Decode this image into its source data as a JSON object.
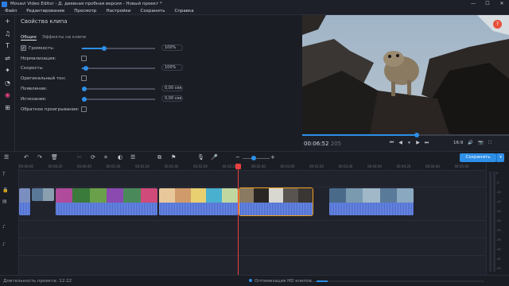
{
  "window": {
    "title": "Movavi Video Editor - Д. диевная пробная версия - Новый проект *",
    "minimize": "—",
    "maximize": "☐",
    "close": "✕"
  },
  "menu": [
    "Файл",
    "Редактирование",
    "Просмотр",
    "Настройки",
    "Сохранить",
    "Справка"
  ],
  "left_tools": [
    {
      "name": "add-media-icon",
      "glyph": "+"
    },
    {
      "name": "music-icon",
      "glyph": "♫"
    },
    {
      "name": "titles-icon",
      "glyph": "T"
    },
    {
      "name": "transitions-icon",
      "glyph": "⇌"
    },
    {
      "name": "filters-icon",
      "glyph": "✦"
    },
    {
      "name": "stickers-icon",
      "glyph": "◔"
    },
    {
      "name": "effects-icon",
      "glyph": "◉"
    },
    {
      "name": "more-tools-icon",
      "glyph": "⊞"
    }
  ],
  "clip_props": {
    "title": "Свойства клипа",
    "tab_general": "Общие",
    "tab_effects": "Эффекты на клипе",
    "volume_label": "Громкость:",
    "volume_value": "100%",
    "volume_pct": 0.3,
    "normalize_label": "Нормализация:",
    "speed_label": "Скорость:",
    "speed_value": "100%",
    "speed_pct": 0.05,
    "original_tone_label": "Оригинальный тон:",
    "fade_in_label": "Появление:",
    "fade_in_value": "0,00 сек",
    "fade_out_label": "Исчезание:",
    "fade_out_value": "0,00 сек",
    "reverse_label": "Обратное проигрывание:"
  },
  "player": {
    "time_main": "00:06:52",
    "time_ms": "205",
    "aspect": "16:9",
    "progress": 0.56,
    "help": "?"
  },
  "timeline": {
    "save_button": "Сохранить",
    "ruler_ticks": [
      "00:00:00",
      "00:00:20",
      "00:00:40",
      "00:01:00",
      "00:01:20",
      "00:01:40",
      "00:02:00",
      "00:02:20",
      "00:02:40",
      "00:03:00",
      "00:03:20",
      "00:03:40",
      "00:04:00",
      "00:04:20",
      "00:04:40",
      "00:05:00"
    ],
    "vu_labels": [
      "0",
      "-5",
      "-10",
      "-15",
      "-20",
      "-25",
      "-30",
      "-35",
      "-40",
      "-45",
      "-50"
    ]
  },
  "status": {
    "duration": "Длительность проекта: 12:22",
    "optimizing": "Оптимизация HD клипов..."
  },
  "colors": {
    "accent": "#2d8fe8",
    "playhead": "#e84040",
    "selection": "#f0a020"
  }
}
